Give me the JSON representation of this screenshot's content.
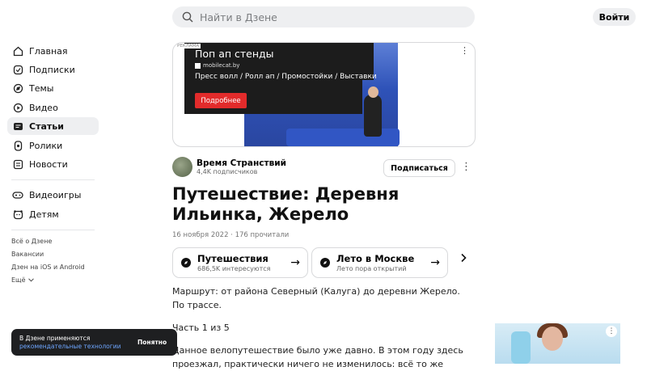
{
  "header": {
    "search_placeholder": "Найти в Дзене",
    "login_label": "Войти"
  },
  "sidebar": {
    "items": [
      {
        "label": "Главная",
        "icon": "home-icon"
      },
      {
        "label": "Подписки",
        "icon": "subscriptions-icon"
      },
      {
        "label": "Темы",
        "icon": "topics-icon"
      },
      {
        "label": "Видео",
        "icon": "video-icon"
      },
      {
        "label": "Статьи",
        "icon": "articles-icon",
        "active": true
      },
      {
        "label": "Ролики",
        "icon": "shorts-icon"
      },
      {
        "label": "Новости",
        "icon": "news-icon"
      },
      {
        "label": "Видеоигры",
        "icon": "gamepad-icon"
      },
      {
        "label": "Детям",
        "icon": "kids-icon"
      }
    ],
    "links": [
      "Всё о Дзене",
      "Вакансии",
      "Дзен на iOS и Android",
      "Ещё"
    ]
  },
  "ad": {
    "mark": "РЕКЛАМА",
    "title": "Поп ап стенды",
    "domain": "mobilecat.by",
    "subtitle": "Пресс волл / Ролл ап / Промостойки / Выставки",
    "button": "Подробнее"
  },
  "channel": {
    "name": "Время Странствий",
    "subscribers": "4,4K подписчиков",
    "subscribe_label": "Подписаться"
  },
  "article": {
    "title": "Путешествие: Деревня Ильинка, Жерело",
    "meta": "16 ноября 2022 · 176 прочитали",
    "tags": [
      {
        "name": "Путешествия",
        "sub": "686,5K интересуются"
      },
      {
        "name": "Лето в Москве",
        "sub": "Лето пора открытий"
      }
    ],
    "paragraphs": [
      "Маршрут: от района Северный (Калуга) до деревни Жерело. По трассе.",
      "Часть 1 из 5",
      "Данное велопутешествие было уже давно. В этом году здесь проезжал, практически ничего не изменилось: всё то же"
    ]
  },
  "cookie": {
    "text": "В Дзене применяются",
    "link": "рекомендательные технологии",
    "button": "Понятно"
  }
}
